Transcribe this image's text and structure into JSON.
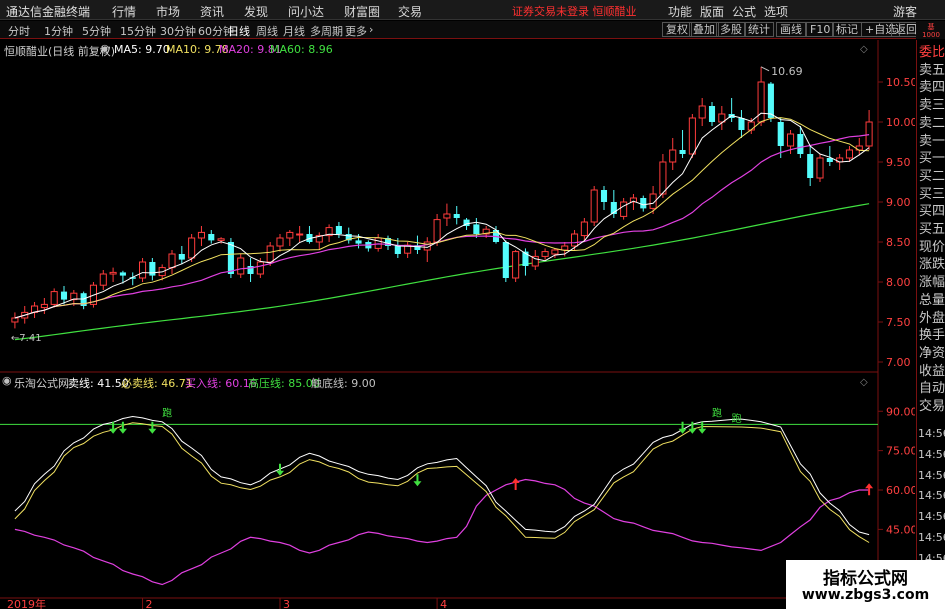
{
  "menubar": {
    "app_title": "通达信金融终端",
    "items": [
      "行情",
      "市场",
      "资讯",
      "发现",
      "问小达",
      "财富圈",
      "交易"
    ],
    "notice": "证券交易未登录  恒顺醋业",
    "right_items": [
      "功能",
      "版面",
      "公式",
      "选项"
    ],
    "guest": "游客"
  },
  "toolbar": {
    "periods": [
      "分时",
      "1分钟",
      "5分钟",
      "15分钟",
      "30分钟",
      "60分钟",
      "日线",
      "周线",
      "月线",
      "多周期",
      "更多"
    ],
    "active_period": "日线",
    "right_buttons": [
      "复权",
      "叠加",
      "多股",
      "统计",
      "画线",
      "F10",
      "标记",
      "+自选",
      "返回"
    ]
  },
  "main_chart": {
    "stock_label": "恒顺醋业(日线 前复权)",
    "ma": [
      {
        "label": "MA5: 9.70",
        "color": "#ffffff"
      },
      {
        "label": "MA10: 9.78",
        "color": "#f0e060"
      },
      {
        "label": "MA20: 9.81",
        "color": "#e040e0"
      },
      {
        "label": "MA60: 8.96",
        "color": "#40e040"
      }
    ],
    "high_label": "10.69",
    "low_label": "7.41",
    "y_ticks": [
      "10.50",
      "10.00",
      "9.50",
      "9.00",
      "8.50",
      "8.00",
      "7.50",
      "7.00"
    ],
    "y_range": [
      6.95,
      10.85
    ]
  },
  "indicator": {
    "name": "乐淘公式网",
    "lines": [
      {
        "label": "卖线: 41.50",
        "color": "#ffffff"
      },
      {
        "label": "必卖线: 46.71",
        "color": "#f0e060"
      },
      {
        "label": "买入线: 60.16",
        "color": "#e040e0"
      },
      {
        "label": "高压线: 85.00",
        "color": "#40e040"
      },
      {
        "label": "触底线: 9.00",
        "color": "#c0c0c0"
      }
    ],
    "y_ticks": [
      "90.00",
      "75.00",
      "60.00",
      "45.00",
      "30.00"
    ],
    "y_range": [
      20,
      100
    ],
    "run_label": "跑"
  },
  "x_axis": {
    "labels": [
      "2019年",
      "2",
      "3",
      "4"
    ]
  },
  "right_panel": {
    "items": [
      "委比",
      "卖五",
      "卖四",
      "卖三",
      "卖二",
      "卖一",
      "买一",
      "买二",
      "买三",
      "买四",
      "买五",
      "现价",
      "涨跌",
      "涨幅",
      "总量",
      "外盘",
      "换手",
      "净资",
      "收益",
      "自动",
      "交易"
    ],
    "times": [
      "14:56",
      "14:56",
      "14:56",
      "14:56",
      "14:56",
      "14:56",
      "14:56",
      "14:56",
      "14:56",
      "14:56"
    ],
    "top_label": "基\n1000"
  },
  "watermark": {
    "line1": "指标公式网",
    "line2": "www.zbgs3.com"
  },
  "chart_data": {
    "type": "candlestick",
    "candles": [
      [
        7.5,
        7.62,
        7.42,
        7.55
      ],
      [
        7.55,
        7.7,
        7.48,
        7.62
      ],
      [
        7.62,
        7.75,
        7.55,
        7.7
      ],
      [
        7.68,
        7.8,
        7.6,
        7.72
      ],
      [
        7.72,
        7.92,
        7.68,
        7.88
      ],
      [
        7.88,
        7.95,
        7.72,
        7.78
      ],
      [
        7.78,
        7.9,
        7.7,
        7.86
      ],
      [
        7.86,
        7.88,
        7.66,
        7.7
      ],
      [
        7.72,
        8.0,
        7.68,
        7.96
      ],
      [
        7.96,
        8.15,
        7.9,
        8.1
      ],
      [
        8.1,
        8.18,
        8.0,
        8.12
      ],
      [
        8.12,
        8.14,
        7.98,
        8.08
      ],
      [
        8.06,
        8.12,
        7.96,
        8.04
      ],
      [
        8.05,
        8.3,
        8.0,
        8.25
      ],
      [
        8.25,
        8.3,
        8.02,
        8.08
      ],
      [
        8.08,
        8.22,
        8.02,
        8.18
      ],
      [
        8.18,
        8.4,
        8.1,
        8.35
      ],
      [
        8.35,
        8.45,
        8.22,
        8.28
      ],
      [
        8.3,
        8.6,
        8.25,
        8.55
      ],
      [
        8.55,
        8.7,
        8.45,
        8.62
      ],
      [
        8.6,
        8.65,
        8.48,
        8.52
      ],
      [
        8.52,
        8.56,
        8.48,
        8.54
      ],
      [
        8.5,
        8.55,
        8.05,
        8.1
      ],
      [
        8.1,
        8.35,
        8.05,
        8.3
      ],
      [
        8.2,
        8.3,
        8.0,
        8.1
      ],
      [
        8.1,
        8.3,
        8.05,
        8.25
      ],
      [
        8.25,
        8.5,
        8.2,
        8.45
      ],
      [
        8.45,
        8.6,
        8.38,
        8.55
      ],
      [
        8.55,
        8.65,
        8.45,
        8.62
      ],
      [
        8.6,
        8.7,
        8.5,
        8.6
      ],
      [
        8.6,
        8.7,
        8.48,
        8.5
      ],
      [
        8.5,
        8.62,
        8.4,
        8.58
      ],
      [
        8.58,
        8.72,
        8.5,
        8.68
      ],
      [
        8.7,
        8.75,
        8.55,
        8.6
      ],
      [
        8.6,
        8.68,
        8.48,
        8.52
      ],
      [
        8.52,
        8.6,
        8.42,
        8.48
      ],
      [
        8.5,
        8.52,
        8.38,
        8.42
      ],
      [
        8.42,
        8.6,
        8.38,
        8.55
      ],
      [
        8.55,
        8.58,
        8.4,
        8.45
      ],
      [
        8.45,
        8.55,
        8.3,
        8.35
      ],
      [
        8.36,
        8.5,
        8.3,
        8.46
      ],
      [
        8.46,
        8.58,
        8.35,
        8.4
      ],
      [
        8.4,
        8.56,
        8.25,
        8.5
      ],
      [
        8.5,
        8.85,
        8.45,
        8.78
      ],
      [
        8.8,
        8.98,
        8.7,
        8.85
      ],
      [
        8.85,
        8.95,
        8.72,
        8.8
      ],
      [
        8.78,
        8.8,
        8.65,
        8.7
      ],
      [
        8.72,
        8.8,
        8.55,
        8.6
      ],
      [
        8.6,
        8.7,
        8.55,
        8.66
      ],
      [
        8.65,
        8.7,
        8.48,
        8.5
      ],
      [
        8.5,
        8.52,
        8.0,
        8.05
      ],
      [
        8.05,
        8.4,
        8.0,
        8.38
      ],
      [
        8.38,
        8.42,
        8.08,
        8.2
      ],
      [
        8.2,
        8.4,
        8.15,
        8.32
      ],
      [
        8.32,
        8.42,
        8.28,
        8.38
      ],
      [
        8.35,
        8.42,
        8.3,
        8.4
      ],
      [
        8.4,
        8.5,
        8.32,
        8.45
      ],
      [
        8.45,
        8.65,
        8.4,
        8.6
      ],
      [
        8.58,
        8.8,
        8.5,
        8.75
      ],
      [
        8.75,
        9.2,
        8.7,
        9.15
      ],
      [
        9.15,
        9.2,
        8.9,
        9.0
      ],
      [
        9.0,
        9.15,
        8.8,
        8.85
      ],
      [
        8.82,
        9.05,
        8.78,
        9.0
      ],
      [
        9.0,
        9.1,
        8.9,
        9.05
      ],
      [
        9.05,
        9.08,
        8.88,
        8.92
      ],
      [
        8.92,
        9.2,
        8.85,
        9.1
      ],
      [
        9.1,
        9.6,
        9.05,
        9.5
      ],
      [
        9.5,
        9.8,
        9.4,
        9.65
      ],
      [
        9.65,
        9.9,
        9.55,
        9.6
      ],
      [
        9.6,
        10.1,
        9.55,
        10.05
      ],
      [
        10.05,
        10.3,
        9.95,
        10.2
      ],
      [
        10.2,
        10.25,
        9.95,
        10.0
      ],
      [
        10.0,
        10.2,
        9.9,
        10.1
      ],
      [
        10.1,
        10.3,
        10.0,
        10.05
      ],
      [
        10.05,
        10.15,
        9.8,
        9.9
      ],
      [
        9.9,
        10.05,
        9.85,
        10.0
      ],
      [
        10.0,
        10.69,
        9.95,
        10.5
      ],
      [
        10.48,
        10.5,
        10.0,
        10.05
      ],
      [
        10.0,
        10.05,
        9.55,
        9.7
      ],
      [
        9.7,
        9.9,
        9.6,
        9.85
      ],
      [
        9.85,
        9.95,
        9.55,
        9.6
      ],
      [
        9.6,
        9.7,
        9.2,
        9.3
      ],
      [
        9.3,
        9.6,
        9.25,
        9.55
      ],
      [
        9.55,
        9.7,
        9.45,
        9.5
      ],
      [
        9.5,
        9.6,
        9.4,
        9.55
      ],
      [
        9.55,
        9.7,
        9.5,
        9.65
      ],
      [
        9.65,
        9.8,
        9.58,
        9.7
      ],
      [
        9.7,
        10.15,
        9.65,
        10.0
      ]
    ]
  }
}
